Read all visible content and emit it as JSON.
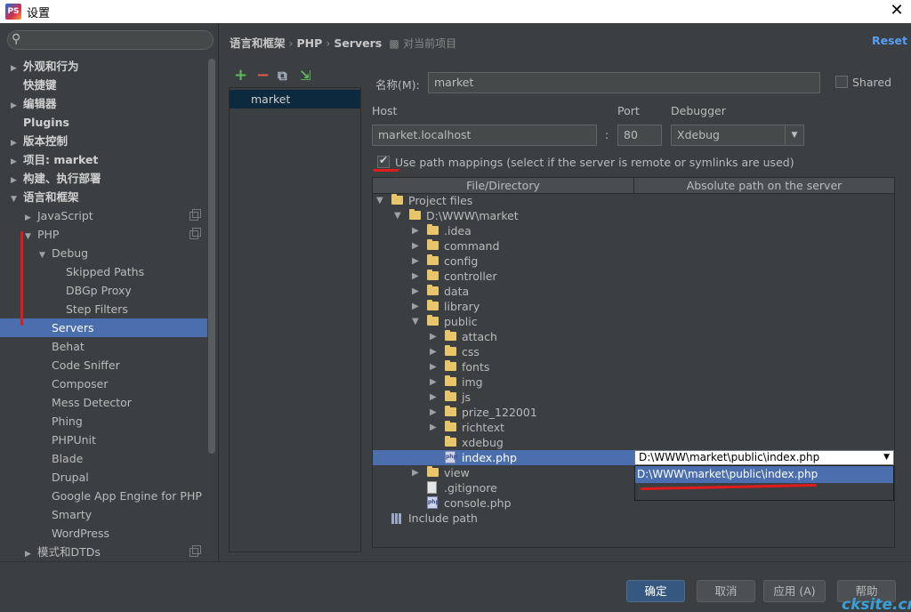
{
  "window": {
    "title": "设置",
    "app_icon": "phpstorm-icon",
    "close_glyph": "✕"
  },
  "sidebar": {
    "search_placeholder": "",
    "items": [
      {
        "label": "外观和行为",
        "arrow": "▶",
        "bold": true
      },
      {
        "label": "快捷键",
        "arrow": "",
        "bold": true
      },
      {
        "label": "编辑器",
        "arrow": "▶",
        "bold": true
      },
      {
        "label": "Plugins",
        "arrow": "",
        "bold": true
      },
      {
        "label": "版本控制",
        "arrow": "▶",
        "bold": true
      },
      {
        "label": "项目: market",
        "arrow": "▶",
        "bold": true
      },
      {
        "label": "构建、执行部署",
        "arrow": "▶",
        "bold": true
      },
      {
        "label": "语言和框架",
        "arrow": "▼",
        "bold": true
      },
      {
        "label": "JavaScript",
        "arrow": "▶",
        "bold": false
      },
      {
        "label": "PHP",
        "arrow": "▼",
        "bold": false
      },
      {
        "label": "Debug",
        "arrow": "▼",
        "bold": false
      },
      {
        "label": "Skipped Paths",
        "arrow": "",
        "bold": false
      },
      {
        "label": "DBGp Proxy",
        "arrow": "",
        "bold": false
      },
      {
        "label": "Step Filters",
        "arrow": "",
        "bold": false
      },
      {
        "label": "Servers",
        "arrow": "",
        "bold": false,
        "selected": true
      },
      {
        "label": "Behat",
        "arrow": "",
        "bold": false
      },
      {
        "label": "Code Sniffer",
        "arrow": "",
        "bold": false
      },
      {
        "label": "Composer",
        "arrow": "",
        "bold": false
      },
      {
        "label": "Mess Detector",
        "arrow": "",
        "bold": false
      },
      {
        "label": "Phing",
        "arrow": "",
        "bold": false
      },
      {
        "label": "PHPUnit",
        "arrow": "",
        "bold": false
      },
      {
        "label": "Blade",
        "arrow": "",
        "bold": false
      },
      {
        "label": "Drupal",
        "arrow": "",
        "bold": false
      },
      {
        "label": "Google App Engine for PHP",
        "arrow": "",
        "bold": false
      },
      {
        "label": "Smarty",
        "arrow": "",
        "bold": false
      },
      {
        "label": "WordPress",
        "arrow": "",
        "bold": false
      },
      {
        "label": "模式和DTDs",
        "arrow": "▶",
        "bold": false
      }
    ]
  },
  "header": {
    "breadcrumb": [
      "语言和框架",
      "PHP",
      "Servers"
    ],
    "separator": "›",
    "project_scope": "对当前项目",
    "reset": "Reset"
  },
  "server_toolbar": {
    "add": "+",
    "remove": "−",
    "copy": "⧉",
    "import": "⇲"
  },
  "servers": [
    {
      "name": "market"
    }
  ],
  "form": {
    "name_label": "名称(M):",
    "name_value": "market",
    "shared_label": "Shared",
    "shared_checked": false,
    "host_label": "Host",
    "host_value": "market.localhost",
    "port_label": "Port",
    "port_value": "80",
    "colon": ":",
    "debugger_label": "Debugger",
    "debugger_value": "Xdebug",
    "use_mappings_label": "Use path mappings (select if the server is remote or symlinks are used)",
    "use_mappings_checked": true
  },
  "mapping": {
    "col_file": "File/Directory",
    "col_server": "Absolute path on the server",
    "tree": [
      {
        "label": "Project files",
        "icon": "folder",
        "arrow": "▼",
        "depth": 0
      },
      {
        "label": "D:\\WWW\\market",
        "icon": "folder",
        "arrow": "▼",
        "depth": 1
      },
      {
        "label": ".idea",
        "icon": "folder",
        "arrow": "▶",
        "depth": 2
      },
      {
        "label": "command",
        "icon": "folder",
        "arrow": "▶",
        "depth": 2
      },
      {
        "label": "config",
        "icon": "folder",
        "arrow": "▶",
        "depth": 2
      },
      {
        "label": "controller",
        "icon": "folder",
        "arrow": "▶",
        "depth": 2
      },
      {
        "label": "data",
        "icon": "folder",
        "arrow": "▶",
        "depth": 2
      },
      {
        "label": "library",
        "icon": "folder",
        "arrow": "▶",
        "depth": 2
      },
      {
        "label": "public",
        "icon": "folder",
        "arrow": "▼",
        "depth": 2
      },
      {
        "label": "attach",
        "icon": "folder",
        "arrow": "▶",
        "depth": 3
      },
      {
        "label": "css",
        "icon": "folder",
        "arrow": "▶",
        "depth": 3
      },
      {
        "label": "fonts",
        "icon": "folder",
        "arrow": "▶",
        "depth": 3
      },
      {
        "label": "img",
        "icon": "folder",
        "arrow": "▶",
        "depth": 3
      },
      {
        "label": "js",
        "icon": "folder",
        "arrow": "▶",
        "depth": 3
      },
      {
        "label": "prize_122001",
        "icon": "folder",
        "arrow": "▶",
        "depth": 3
      },
      {
        "label": "richtext",
        "icon": "folder",
        "arrow": "▶",
        "depth": 3
      },
      {
        "label": "xdebug",
        "icon": "folder",
        "arrow": "",
        "depth": 3
      },
      {
        "label": "index.php",
        "icon": "php",
        "arrow": "",
        "depth": 3,
        "selected": true
      },
      {
        "label": "view",
        "icon": "folder",
        "arrow": "▶",
        "depth": 2
      },
      {
        "label": ".gitignore",
        "icon": "file",
        "arrow": "",
        "depth": 2
      },
      {
        "label": "console.php",
        "icon": "php",
        "arrow": "",
        "depth": 2
      },
      {
        "label": "Include path",
        "icon": "library",
        "arrow": "",
        "depth": 0
      }
    ],
    "server_path_value": "D:\\WWW\\market\\public\\index.php",
    "server_path_option": "D:\\WWW\\market\\public\\index.php"
  },
  "buttons": {
    "ok": "确定",
    "cancel": "取消",
    "apply": "应用 (A)",
    "help": "帮助"
  },
  "watermark": "cksite.cn",
  "colors": {
    "background": "#3c3f41",
    "selection": "#4b6eaf",
    "link": "#589df6",
    "annotation": "#e01b1b"
  }
}
